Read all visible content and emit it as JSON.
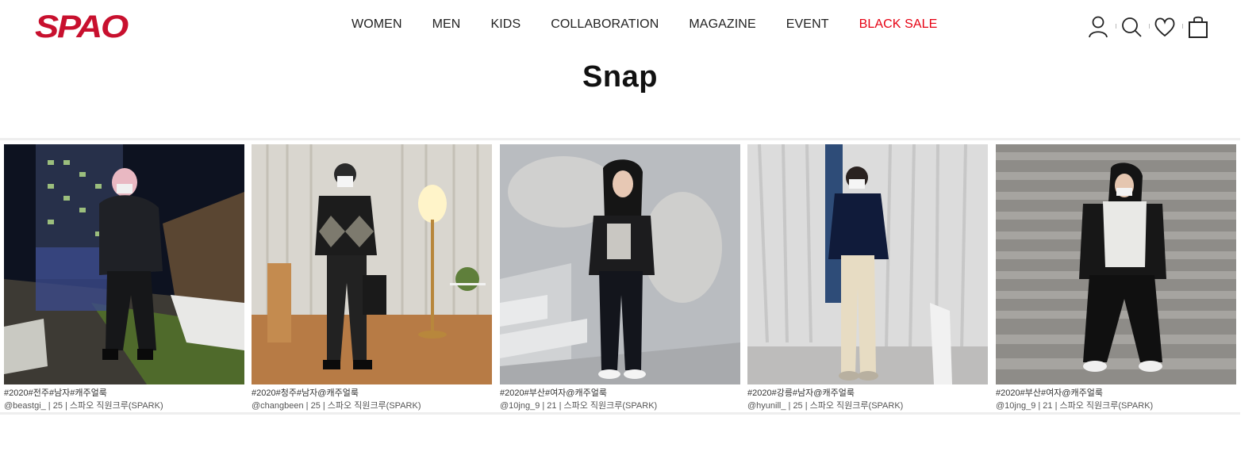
{
  "brand": {
    "logo_text": "SPAO",
    "color": "#c8102e"
  },
  "nav": {
    "items": [
      "WOMEN",
      "MEN",
      "KIDS",
      "COLLABORATION",
      "MAGAZINE",
      "EVENT"
    ],
    "sale": "BLACK SALE",
    "sale_color": "#e60012"
  },
  "header_icons": [
    "user-icon",
    "search-icon",
    "heart-icon",
    "shopping-bag-icon"
  ],
  "page": {
    "title": "Snap"
  },
  "snaps": [
    {
      "tags": "#2020#전주#남자#캐주얼룩",
      "info": "@beastgi_ | 25 | 스파오 직원크루(SPARK)"
    },
    {
      "tags": "#2020#청주#남자@캐주얼룩",
      "info": "@changbeen | 25 | 스파오 직원크루(SPARK)"
    },
    {
      "tags": "#2020#부산#여자@캐주얼룩",
      "info": "@10jng_9 | 21 | 스파오 직원크루(SPARK)"
    },
    {
      "tags": "#2020#강릉#남자@캐주얼룩",
      "info": "@hyunill_ | 25 | 스파오 직원크루(SPARK)"
    },
    {
      "tags": "#2020#부산#여자@캐주얼룩",
      "info": "@10jng_9 | 21 | 스파오 직원크루(SPARK)"
    }
  ]
}
